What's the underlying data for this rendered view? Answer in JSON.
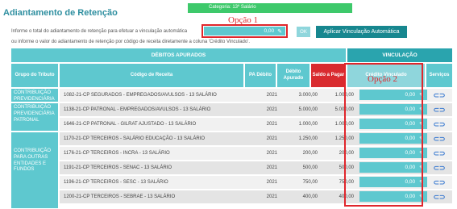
{
  "page": {
    "title": "Adiantamento de Retenção",
    "category": "Categoria: 13º Salário",
    "instruction_1": "Informe o total do adiantamento de retenção para efetuar a vinculação automática",
    "instruction_2": "ou informe o valor do adiantamento de retenção por código de receita diretamente a coluna 'Crédito Vinculado'.",
    "auto_value": "0,00",
    "ok_label": "OK",
    "apply_label": "Aplicar Vinculação Automática",
    "opcao1": "Opção 1",
    "opcao2": "Opção 2"
  },
  "table": {
    "section_debitos": "DÉBITOS APURADOS",
    "section_vinculacao": "VINCULAÇÃO",
    "columns": {
      "grupo": "Grupo do Tributo",
      "codigo": "Código de Receita",
      "pa": "PA Débito",
      "debito": "Débito Apurado",
      "saldo": "Saldo a Pagar",
      "credito": "Crédito Vinculado",
      "servicos": "Serviços"
    },
    "groups": [
      {
        "label": "CONTRIBUIÇÃO PREVIDENCIÁRIA SEGURADOS"
      },
      {
        "label": "CONTRIBUIÇÃO PREVIDENCIÁRIA PATRONAL"
      },
      {
        "label": "CONTRIBUIÇÃO PARA OUTRAS ENTIDADES E FUNDOS"
      }
    ],
    "rows": [
      {
        "codigo": "1082-21-CP SEGURADOS - EMPREGADOS/AVULSOS - 13 SALÁRIO",
        "pa": "2021",
        "debito": "3.000,00",
        "saldo": "1.000,00",
        "credito": "0,00"
      },
      {
        "codigo": "1138-21-CP PATRONAL - EMPREGADOS/AVULSOS - 13 SALÁRIO",
        "pa": "2021",
        "debito": "5.000,00",
        "saldo": "5.000,00",
        "credito": "0,00"
      },
      {
        "codigo": "1646-21-CP PATRONAL - GILRAT AJUSTADO - 13 SALÁRIO",
        "pa": "2021",
        "debito": "1.000,00",
        "saldo": "1.000,00",
        "credito": "0,00"
      },
      {
        "codigo": "1170-21-CP TERCEIROS - SALÁRIO EDUCAÇÃO - 13 SALÁRIO",
        "pa": "2021",
        "debito": "1.250,00",
        "saldo": "1.250,00",
        "credito": "0,00"
      },
      {
        "codigo": "1176-21-CP TERCEIROS - INCRA - 13 SALÁRIO",
        "pa": "2021",
        "debito": "200,00",
        "saldo": "200,00",
        "credito": "0,00"
      },
      {
        "codigo": "1191-21-CP TERCEIROS - SENAC - 13 SALÁRIO",
        "pa": "2021",
        "debito": "500,00",
        "saldo": "500,00",
        "credito": "0,00"
      },
      {
        "codigo": "1196-21-CP TERCEIROS - SESC - 13 SALÁRIO",
        "pa": "2021",
        "debito": "750,00",
        "saldo": "750,00",
        "credito": "0,00"
      },
      {
        "codigo": "1200-21-CP TERCEIROS - SEBRAE - 13 SALÁRIO",
        "pa": "2021",
        "debito": "400,00",
        "saldo": "400,00",
        "credito": "0,00"
      }
    ],
    "service_icon": "link-icon"
  },
  "colors": {
    "teal_light": "#5ec8cf",
    "teal_dark": "#17878f",
    "saldo_red": "#d92b2f",
    "highlight_red": "#e0262c",
    "badge_green": "#3ec96b"
  }
}
